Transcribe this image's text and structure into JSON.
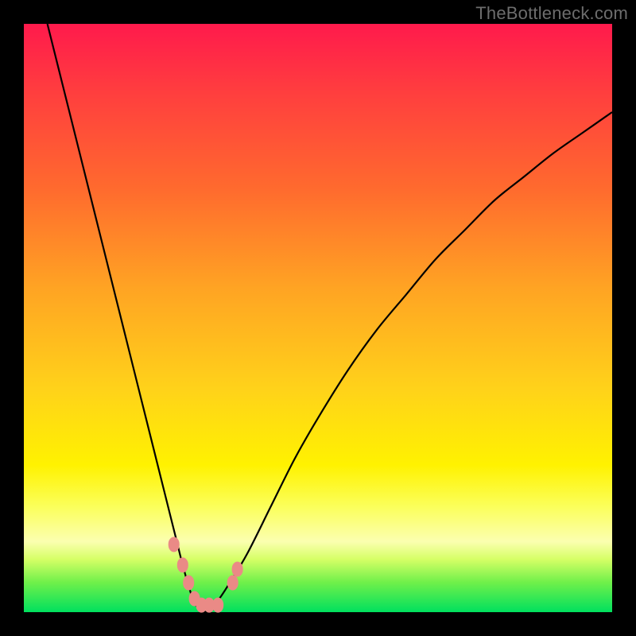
{
  "watermark": "TheBottleneck.com",
  "colors": {
    "frame": "#000000",
    "curve": "#000000",
    "marker": "#ea8a86",
    "gradient_stops": [
      "#ff1a4c",
      "#ff3f3e",
      "#ff6a2e",
      "#ffa423",
      "#ffd21a",
      "#fff200",
      "#fbff5a",
      "#fbffb0",
      "#d6ff66",
      "#6ef04a",
      "#00e05e"
    ]
  },
  "chart_data": {
    "type": "line",
    "title": "",
    "xlabel": "",
    "ylabel": "",
    "xlim": [
      0,
      100
    ],
    "ylim": [
      0,
      100
    ],
    "note": "x/y in percent of plot area; y=0 is bottom edge (green), y=100 top edge (red). Two curves form a V with minimum ~x≈29.",
    "series": [
      {
        "name": "left-branch",
        "x": [
          4,
          6,
          8,
          10,
          12,
          14,
          16,
          18,
          20,
          22,
          24,
          26,
          27,
          28,
          29,
          30,
          31
        ],
        "y": [
          100,
          92,
          84,
          76,
          68,
          60,
          52,
          44,
          36,
          28,
          20,
          12,
          8,
          4.5,
          1.5,
          0.5,
          0
        ]
      },
      {
        "name": "right-branch",
        "x": [
          31,
          33,
          35,
          38,
          42,
          46,
          50,
          55,
          60,
          65,
          70,
          75,
          80,
          85,
          90,
          95,
          100
        ],
        "y": [
          0,
          2,
          5,
          10,
          18,
          26,
          33,
          41,
          48,
          54,
          60,
          65,
          70,
          74,
          78,
          81.5,
          85
        ]
      }
    ],
    "markers": {
      "name": "highlight-dots",
      "color": "#ea8a86",
      "points": [
        {
          "x": 25.5,
          "y": 11.5
        },
        {
          "x": 27.0,
          "y": 8.0
        },
        {
          "x": 28.0,
          "y": 5.0
        },
        {
          "x": 29.0,
          "y": 2.3
        },
        {
          "x": 30.2,
          "y": 1.2
        },
        {
          "x": 31.5,
          "y": 1.2
        },
        {
          "x": 33.0,
          "y": 1.2
        },
        {
          "x": 35.5,
          "y": 5.0
        },
        {
          "x": 36.3,
          "y": 7.3
        }
      ]
    }
  }
}
